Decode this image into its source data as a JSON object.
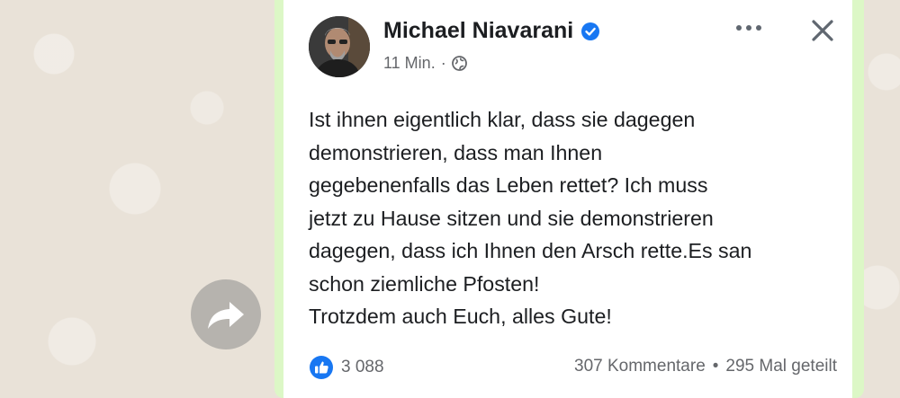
{
  "post": {
    "author": "Michael Niavarani",
    "verified": true,
    "time": "11 Min.",
    "separator": "·",
    "audience_icon": "globe-icon",
    "text_lines": [
      "Ist ihnen eigentlich klar, dass sie dagegen",
      "demonstrieren, dass man Ihnen",
      "gegebenenfalls das Leben rettet? Ich muss",
      "jetzt zu Hause sitzen und sie demonstrieren",
      "dagegen, dass ich Ihnen den Arsch rette.Es san",
      "schon ziemliche Pfosten!",
      "Trotzdem auch Euch, alles Gute!"
    ],
    "reactions_count": "3 088",
    "comments": "307 Kommentare",
    "stats_separator": "•",
    "shares": "295 Mal geteilt",
    "more_icon": "more-options-icon",
    "close_icon": "close-icon"
  },
  "chat": {
    "forward_icon": "forward-icon"
  },
  "colors": {
    "bubble": "#dcf7c6",
    "wallpaper": "#e9e2d8",
    "verified_blue": "#1877f2",
    "like_blue": "#1877f2"
  }
}
